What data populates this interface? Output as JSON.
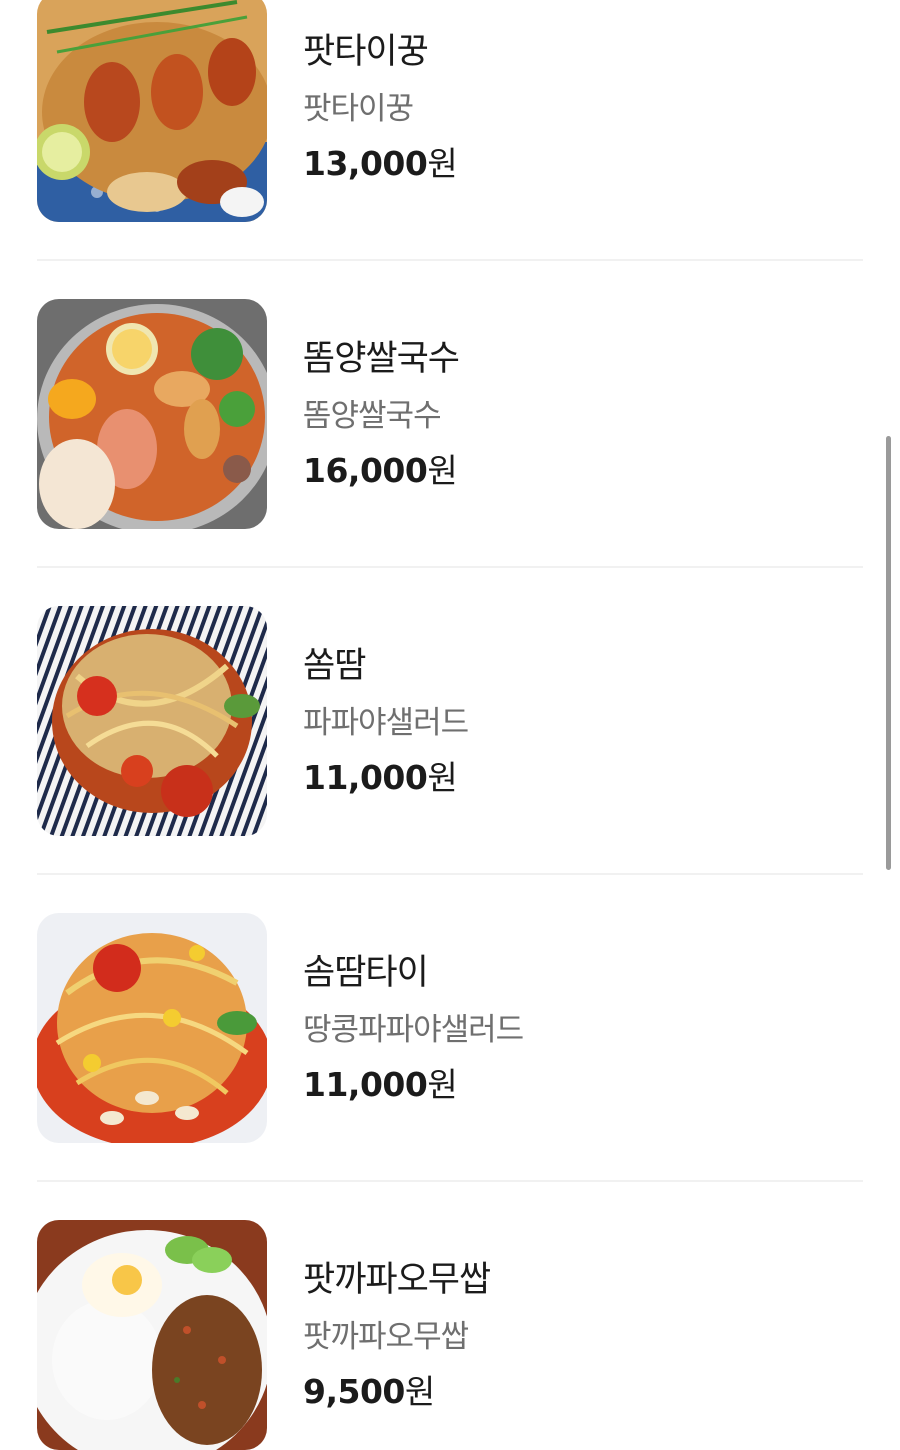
{
  "menu": {
    "items": [
      {
        "name": "팟타이꿍",
        "description": "팟타이꿍",
        "price": "13,000",
        "currency": "원",
        "image_icon": "pad-thai-shrimp-photo"
      },
      {
        "name": "똠양쌀국수",
        "description": "똠양쌀국수",
        "price": "16,000",
        "currency": "원",
        "image_icon": "tom-yum-noodle-photo"
      },
      {
        "name": "쏨땀",
        "description": "파파야샐러드",
        "price": "11,000",
        "currency": "원",
        "image_icon": "papaya-salad-photo"
      },
      {
        "name": "솜땀타이",
        "description": "땅콩파파야샐러드",
        "price": "11,000",
        "currency": "원",
        "image_icon": "peanut-papaya-salad-photo"
      },
      {
        "name": "팟까파오무쌉",
        "description": "팟까파오무쌉",
        "price": "9,500",
        "currency": "원",
        "image_icon": "basil-pork-rice-photo"
      }
    ]
  },
  "colors": {
    "text": "#1b1b1b",
    "subtext": "#6f6f6f",
    "divider": "#f1f1f1",
    "scrollbar": "#9a9a9a"
  }
}
